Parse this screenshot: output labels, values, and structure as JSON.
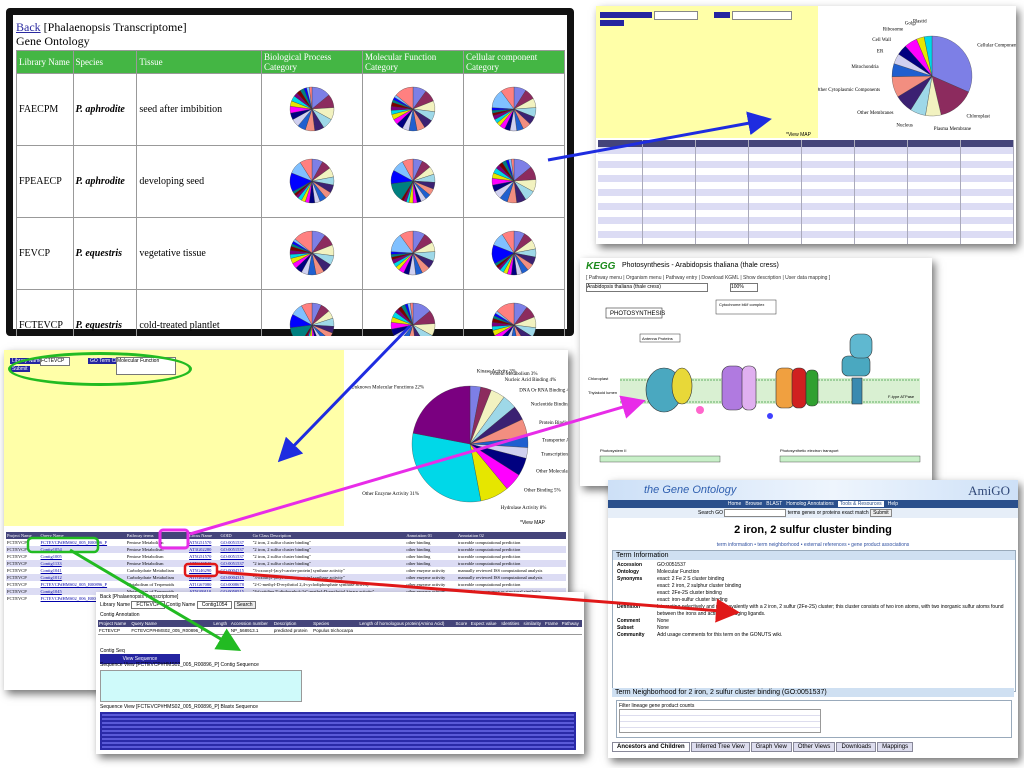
{
  "colors": {
    "pie": [
      "#7d7fe6",
      "#8c2b5e",
      "#f2f2c0",
      "#9ed8e8",
      "#3b2172",
      "#f28e80",
      "#1f5fcf",
      "#d0d0f0",
      "#000080",
      "#ff00ff",
      "#e6e600",
      "#00d8e8",
      "#7a0080",
      "#7a0000",
      "#008080",
      "#0000ff",
      "#80c0ff",
      "#ff8080"
    ],
    "header_green": "#44b644",
    "arrow_blue": "#1e2ce0",
    "arrow_magenta": "#e82ce8",
    "arrow_red": "#e01818",
    "arrow_green": "#22bb22"
  },
  "panelA": {
    "back": "Back",
    "project": "[Phalaenopsis Transcriptome]",
    "title": "Gene Ontology",
    "headers": [
      "Library Name",
      "Species",
      "Tissue",
      "Biological Process Category",
      "Molecular Function Category",
      "Cellular component Category"
    ],
    "rows": [
      {
        "lib": "FAECPM",
        "species": "P. aphrodite",
        "tissue": "seed after imbibition"
      },
      {
        "lib": "FPEAECP",
        "species": "P. aphrodite",
        "tissue": "developing seed"
      },
      {
        "lib": "FEVCP",
        "species": "P. equestris",
        "tissue": "vegetative tissue"
      },
      {
        "lib": "FCTEVCP",
        "species": "P. equestris",
        "tissue": "cold-treated plantlet"
      }
    ]
  },
  "panelB": {
    "legend": [
      "Cellular Component Unknown",
      "Chloroplast",
      "Plasma Membrane",
      "Nucleus",
      "Other Membranes",
      "Other Cytoplasmic Components",
      "Mitochondria",
      "ER",
      "Cell Wall",
      "Ribosome",
      "Golgi",
      "Plastid"
    ],
    "footer": "*View MAP"
  },
  "panelC": {
    "logo": "KEGG",
    "title": "Photosynthesis - Arabidopsis thaliana (thale cress)",
    "menu": "[ Pathway menu | Organism menu | Pathway entry | Download KGML | Show description | User data mapping ]",
    "select": "Arabidopsis thaliana (thale cress)",
    "zoom": "100%",
    "heading": "PHOTOSYNTHESIS",
    "labels": [
      "Photosystem II",
      "Cytochrome b6/f complex",
      "Photosystem I",
      "F-type ATPase",
      "Chloroplast",
      "Thylakoid lumen",
      "Stroma",
      "Photosynthetic electron transport",
      "Antenna Proteins"
    ]
  },
  "panelD": {
    "select_label": "Library Name",
    "select_value": "FCTEVCP",
    "go_label": "GO Term Class",
    "go_value": "Molecular Function",
    "submit": "Submit",
    "pie_labels": [
      "Kinase Activity",
      "Protein Metabolism",
      "Nucleic Acid Binding",
      "DNA Or RNA Binding",
      "Nucleotide Binding",
      "Protein Binding",
      "Transporter Activity",
      "Transcription Factor Activity",
      "Other Molecular Functions",
      "Other Binding",
      "Hydrolase Activity",
      "Other Enzyme Activity",
      "Unknown Molecular Functions"
    ],
    "pie_values": [
      3,
      3,
      4,
      4,
      4,
      5,
      3,
      3,
      5,
      5,
      8,
      31,
      22
    ],
    "pie_pct": [
      "3%",
      "3%",
      "4%",
      "4%",
      "4%",
      "5%",
      "3%",
      "3%",
      "5%",
      "5%",
      "8%",
      "31%",
      "22%"
    ],
    "footer": "*View MAP",
    "table_headers": [
      "Project Name",
      "Query Name",
      "Pathway terms",
      "Locus Name",
      "GOID",
      "Go Class Description",
      "Annotation 01",
      "Annotation 02"
    ],
    "table_rows": [
      [
        "FCTEVCP",
        "FCTEVCP#HMS02_005_R00896_P",
        "Pentose Metabolism",
        "AT5G51570",
        "GO:0051537",
        "\"2 iron, 2 sulfur cluster binding\"",
        "other binding",
        "traceable computational prediction"
      ],
      [
        "FCTEVCP",
        "Contig1054",
        "Pentose Metabolism",
        "AT3G02280",
        "GO:0051537",
        "\"2 iron, 2 sulfur cluster binding\"",
        "other binding",
        "traceable computational prediction"
      ],
      [
        "FCTEVCP",
        "Contig1005",
        "Pentose Metabolism",
        "AT5G51570",
        "GO:0051537",
        "\"2 iron, 2 sulfur cluster binding\"",
        "other binding",
        "traceable computational prediction"
      ],
      [
        "FCTEVCP",
        "Contig1133",
        "Pentose Metabolism",
        "AT5G46540",
        "GO:0051537",
        "\"2 iron, 2 sulfur cluster binding\"",
        "other binding",
        "traceable computational prediction"
      ],
      [
        "FCTEVCP",
        "Contig1041",
        "Carbohydrate Metabolism",
        "AT5G46290",
        "GO:0004315",
        "\"3-oxoacyl-[acyl-carrier-protein] synthase activity\"",
        "other enzyme activity",
        "manually reviewed ISS computational analysis"
      ],
      [
        "FCTEVCP",
        "Contig1012",
        "Carbohydrate Metabolism",
        "AT1G62640",
        "GO:0004315",
        "\"3-oxoacyl-[acyl-carrier-protein] synthase activity\"",
        "other enzyme activity",
        "manually reviewed ISS computational analysis"
      ],
      [
        "FCTEVCP",
        "FCTEVCP#HMS02_005_R00896_P",
        "Metabolism of Terpenoids",
        "AT1G67080",
        "GO:0008678",
        "\"2-C-methyl-D-erythritol 2,4-cyclodiphosphate synthase activity\"",
        "other enzyme activity",
        "traceable computational prediction"
      ],
      [
        "FCTEVCP",
        "Contig1045",
        "Metabolism of Terpenoids",
        "AT5G09110",
        "GO:0050515",
        "\"4-(cytidine 5'-diphospho)-2-C-methyl-D-erythritol kinase activity\"",
        "other enzyme activity",
        "inferred from sequence or structural similarity"
      ],
      [
        "FCTEVCP",
        "FCTEVCP#HMS02_006_R00897_P",
        "Metabolism of Terpenoids",
        "AT4G34350",
        "GO:0051745",
        "\"4-hydroxy-3-methylbut-2-enyl diphosphate reductase activity\"",
        "other enzyme activity",
        "traceable computational prediction"
      ]
    ]
  },
  "panelE": {
    "back": "Back [Phalaenopsis Transcriptome]",
    "library_label": "Library Name",
    "library_value": "FCTEVCP",
    "contig_label": "Contig Name",
    "contig_value": "Contig1054",
    "search": "Search",
    "section": "Contig Annotation",
    "headers": [
      "Project Name",
      "Query Name",
      "Length",
      "Accession number",
      "Description",
      "Species",
      "Length of homologous protein(Amino Acid)",
      "Score",
      "Expect value",
      "Identities",
      "similarity",
      "Frame",
      "Pathway"
    ],
    "row": [
      "FCTEVCP",
      "FCTEVCP#HMS02_005_R00896_P",
      "",
      "NP_568913.1",
      "predicted protein",
      "Populus trichocarpa",
      "",
      "",
      "",
      "",
      "",
      "",
      ""
    ],
    "seq_label": "Contig Seq",
    "seq_button": "View Sequence",
    "seq_title": "Sequence View [FCTEVCP#HMS02_005_R00896_P] Contig Sequence",
    "seq_title2": "Sequence View [FCTEVCP#HMS02_005_R00896_P] Blastx Sequence"
  },
  "panelF": {
    "brand": "the Gene Ontology",
    "brand_right": "AmiGO",
    "nav": [
      "Home",
      "Browse",
      "BLAST",
      "Homolog Annotations",
      "Tools & Resources",
      "Help"
    ],
    "search_label": "Search GO",
    "search_opts": [
      "terms",
      "genes or proteins",
      "exact match"
    ],
    "search_btn": "Submit",
    "term": "2 iron, 2 sulfur cluster binding",
    "info_header": "Term Information",
    "subnav": "term information • term neighborhood • external references • gene product associations",
    "fields": [
      {
        "k": "Accession",
        "v": "GO:0051537"
      },
      {
        "k": "Ontology",
        "v": "Molecular Function"
      },
      {
        "k": "Synonyms",
        "v": "exact: 2 Fe 2 S cluster binding"
      },
      {
        "k": "",
        "v": "exact: 2 iron, 2 sulphur cluster binding"
      },
      {
        "k": "",
        "v": "exact: 2Fe-2S cluster binding"
      },
      {
        "k": "",
        "v": "exact: iron-sulfur cluster binding"
      },
      {
        "k": "Definition",
        "v": "Interacting selectively and non-covalently with a 2 iron, 2 sulfur (2Fe-2S) cluster; this cluster consists of two iron atoms, with two inorganic sulfur atoms found between the irons and acting as bridging ligands."
      },
      {
        "k": "Comment",
        "v": "None"
      },
      {
        "k": "Subset",
        "v": "None"
      },
      {
        "k": "Community",
        "v": "Add usage comments for this term on the GONUTS wiki."
      }
    ],
    "neighborhood": "Term Neighborhood for 2 iron, 2 sulfur cluster binding (GO:0051537)",
    "filter": "Filter lineage gene product counts",
    "tabs": [
      "Ancestors and Children",
      "Inferred Tree View",
      "Graph View",
      "Other Views",
      "Downloads",
      "Mappings"
    ]
  }
}
